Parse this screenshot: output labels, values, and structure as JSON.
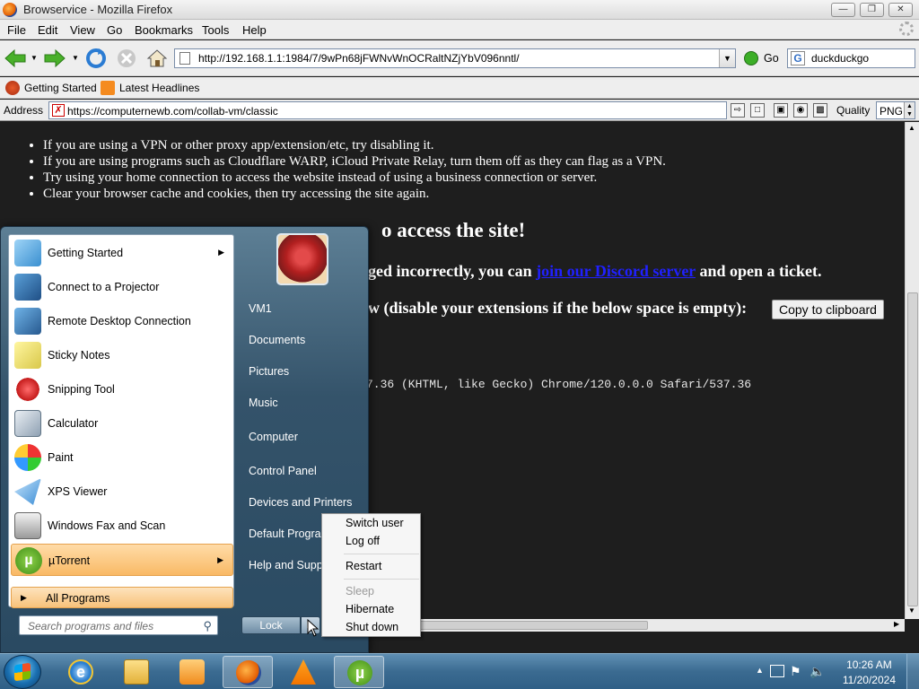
{
  "window": {
    "title": "Browservice - Mozilla Firefox"
  },
  "menubar": {
    "items": [
      "File",
      "Edit",
      "View",
      "Go",
      "Bookmarks",
      "Tools",
      "Help"
    ]
  },
  "navbar": {
    "url": "http://192.168.1.1:1984/7/9wPn68jFWNvWnOCRaltNZjYbV096nntl/",
    "go_label": "Go",
    "search_value": "duckduckgo"
  },
  "bookmarks": {
    "items": [
      "Getting Started",
      "Latest Headlines"
    ]
  },
  "addressbar": {
    "label": "Address",
    "url": "https://computernewb.com/collab-vm/classic",
    "quality_label": "Quality",
    "quality_value": "PNG"
  },
  "page": {
    "bullets": [
      "If you are using a VPN or other proxy app/extension/etc, try disabling it.",
      "If you are using programs such as Cloudflare WARP, iCloud Private Relay, turn them off as they can flag as a VPN.",
      "Try using your home connection to access the website instead of using a business connection or server.",
      "Clear your browser cache and cookies, then try accessing the site again."
    ],
    "heading_fragment": "o access the site!",
    "line2_fragment": "ged incorrectly, you can",
    "line2_link": "join our Discord server",
    "line2_end": "and open a ticket.",
    "line3_fragment": "w (disable your extensions if the below space is empty):",
    "copy_button": "Copy to clipboard",
    "useragent_fragment": "7.36 (KHTML, like Gecko) Chrome/120.0.0.0 Safari/537.36"
  },
  "startmenu": {
    "programs": [
      {
        "label": "Getting Started",
        "has_submenu": true
      },
      {
        "label": "Connect to a Projector",
        "has_submenu": false
      },
      {
        "label": "Remote Desktop Connection",
        "has_submenu": false
      },
      {
        "label": "Sticky Notes",
        "has_submenu": false
      },
      {
        "label": "Snipping Tool",
        "has_submenu": false
      },
      {
        "label": "Calculator",
        "has_submenu": false
      },
      {
        "label": "Paint",
        "has_submenu": false
      },
      {
        "label": "XPS Viewer",
        "has_submenu": false
      },
      {
        "label": "Windows Fax and Scan",
        "has_submenu": false
      },
      {
        "label": "µTorrent",
        "has_submenu": true
      }
    ],
    "all_programs": "All Programs",
    "search_placeholder": "Search programs and files",
    "right_links": [
      "VM1",
      "Documents",
      "Pictures",
      "Music",
      "Computer",
      "Control Panel",
      "Devices and Printers",
      "Default Programs",
      "Help and Support"
    ],
    "lock_label": "Lock"
  },
  "power_menu": {
    "items": [
      {
        "label": "Switch user",
        "enabled": true
      },
      {
        "label": "Log off",
        "enabled": true
      },
      {
        "label": "Restart",
        "enabled": true
      },
      {
        "label": "Sleep",
        "enabled": false
      },
      {
        "label": "Hibernate",
        "enabled": true
      },
      {
        "label": "Shut down",
        "enabled": true
      }
    ]
  },
  "taskbar": {
    "time": "10:26 AM",
    "date": "11/20/2024",
    "pinned": [
      "internet-explorer",
      "windows-explorer",
      "media-player",
      "firefox",
      "vlc",
      "utorrent"
    ]
  }
}
